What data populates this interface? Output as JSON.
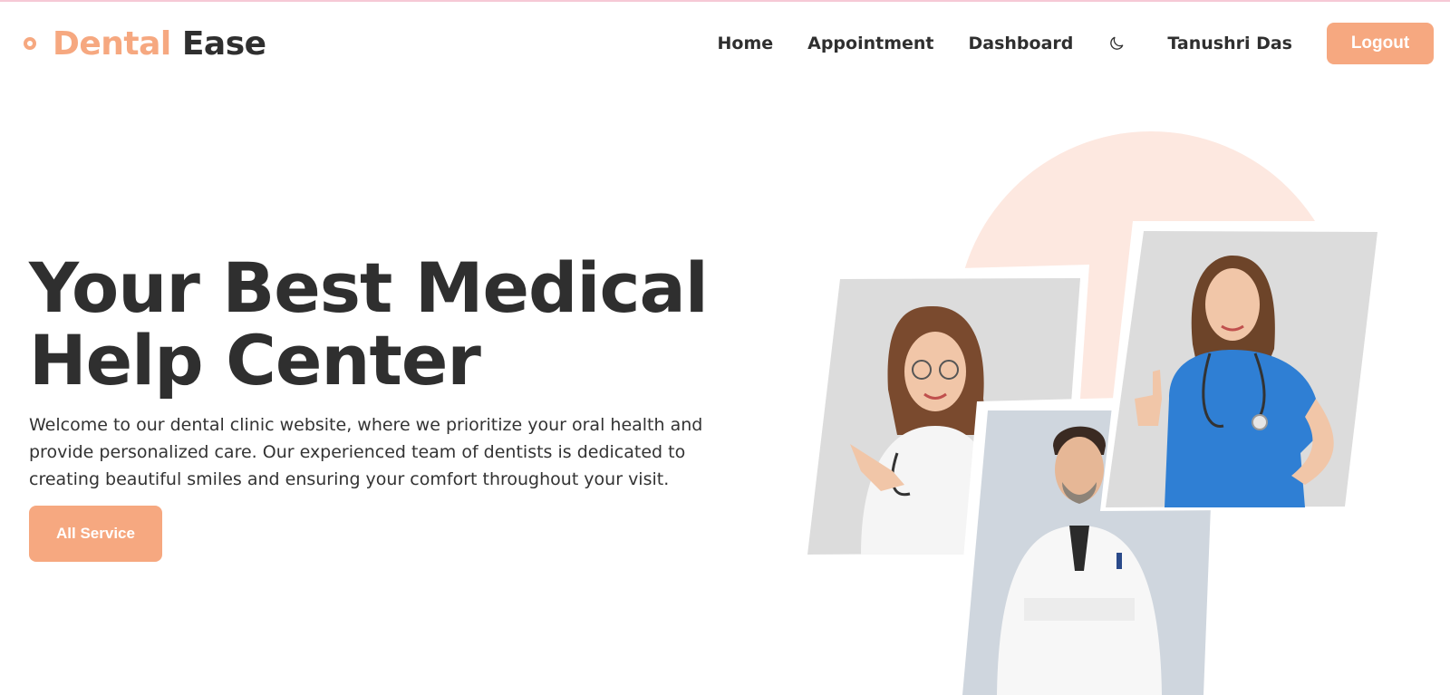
{
  "brand": {
    "accent": "Dental",
    "rest": "Ease"
  },
  "nav": {
    "links": [
      "Home",
      "Appointment",
      "Dashboard"
    ],
    "theme_icon": "moon-icon",
    "user_name": "Tanushri Das",
    "logout_label": "Logout"
  },
  "hero": {
    "title_line1": "Your Best Medical",
    "title_line2": "Help Center",
    "description": "Welcome to our dental clinic website, where we prioritize your oral health and provide personalized care. Our experienced team of dentists is dedicated to creating beautiful smiles and ensuring your comfort throughout your visit.",
    "cta_label": "All Service"
  },
  "colors": {
    "accent": "#f6a880",
    "accent_soft": "#fde8e0",
    "text": "#2f2f2f",
    "photo_bg": "#dcdcdc"
  },
  "images": [
    {
      "name": "female-doctor-glasses-photo"
    },
    {
      "name": "male-doctor-photo"
    },
    {
      "name": "nurse-blue-scrubs-photo"
    }
  ]
}
